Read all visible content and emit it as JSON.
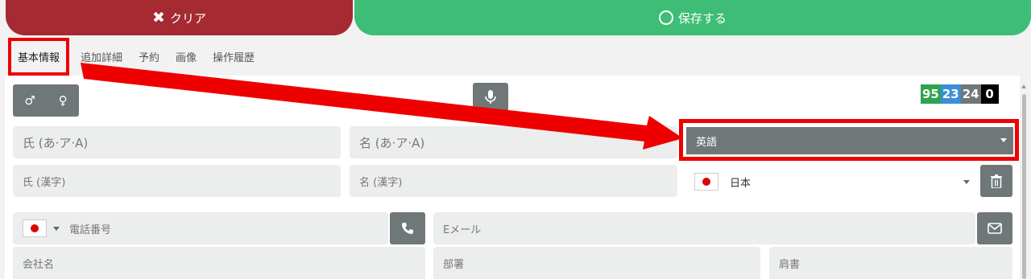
{
  "header": {
    "clear_label": "クリア",
    "save_label": "保存する",
    "clear_color": "#a52a32",
    "save_color": "#3dbd76"
  },
  "tabs": [
    {
      "label": "基本情報",
      "active": true
    },
    {
      "label": "追加詳細",
      "active": false
    },
    {
      "label": "予約",
      "active": false
    },
    {
      "label": "画像",
      "active": false
    },
    {
      "label": "操作履歴",
      "active": false
    }
  ],
  "gender": {
    "male": "♂",
    "female": "♀"
  },
  "counters": [
    {
      "value": "95",
      "color": "#2ea44f"
    },
    {
      "value": "23",
      "color": "#3b8fd9"
    },
    {
      "value": "24",
      "color": "#6f7778"
    },
    {
      "value": "0",
      "color": "#000000"
    }
  ],
  "form": {
    "last_name_kana_placeholder": "氏 (あ·ア·A)",
    "first_name_kana_placeholder": "名 (あ·ア·A)",
    "language_value": "英語",
    "last_name_kanji_placeholder": "氏 (漢字)",
    "first_name_kanji_placeholder": "名 (漢字)",
    "country_value": "日本",
    "phone_placeholder": "電話番号",
    "email_placeholder": "Eメール",
    "company_placeholder": "会社名",
    "department_placeholder": "部署",
    "title_placeholder": "肩書"
  },
  "annotation_color": "#ee0000"
}
